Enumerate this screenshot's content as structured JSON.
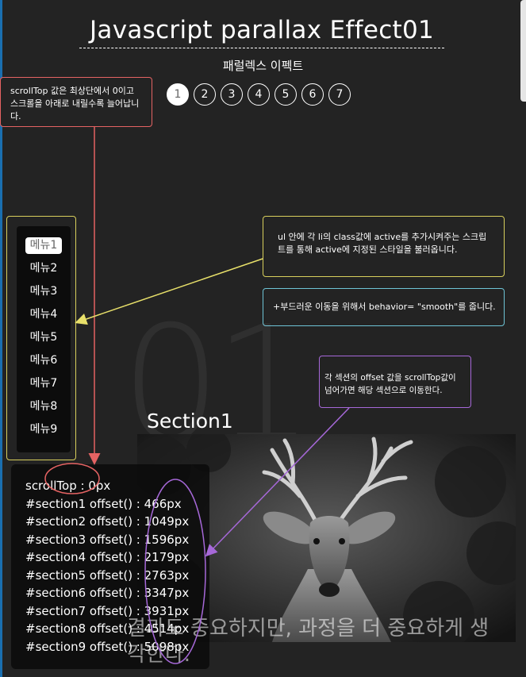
{
  "header": {
    "title": "Javascript parallax Effect01",
    "subtitle": "패럴렉스 이펙트"
  },
  "pager": {
    "items": [
      "1",
      "2",
      "3",
      "4",
      "5",
      "6",
      "7"
    ],
    "active_index": 0
  },
  "notes": {
    "scrolltop": "scrollTop 값은 최상단에서 0이고 스크롤을 아래로 내릴수록 늘어납니다.",
    "active_class": "ul 안에 각 li의 class값에 active를 추가시켜주는 스크립트를 통해 active에 지정된 스타일을 불러옵니다.",
    "smooth": "+부드러운 이동을 위해서 behavior= \"smooth\"를 줍니다.",
    "offset": "각 섹션의 offset 값을 scrollTop값이 넘어가면 해당 섹션으로 이동한다."
  },
  "menu": {
    "items": [
      "메뉴1",
      "메뉴2",
      "메뉴3",
      "메뉴4",
      "메뉴5",
      "메뉴6",
      "메뉴7",
      "메뉴8",
      "메뉴9"
    ],
    "active_index": 0
  },
  "section": {
    "number": "01",
    "title": "Section1",
    "quote": "결과도 중요하지만, 과정을 더 중요하게 생각한다."
  },
  "info": {
    "lines": [
      "scrollTop : 0px",
      "#section1 offset() : 466px",
      "#section2 offset() : 1049px",
      "#section3 offset() : 1596px",
      "#section4 offset() : 2179px",
      "#section5 offset() : 2763px",
      "#section6 offset() : 3347px",
      "#section7 offset() : 3931px",
      "#section8 offset() : 4514px",
      "#section9 offset() : 5098px"
    ]
  },
  "colors": {
    "red": "#e56363",
    "yellow": "#e8e06a",
    "cyan": "#6ec4d6",
    "purple": "#a668d8"
  }
}
